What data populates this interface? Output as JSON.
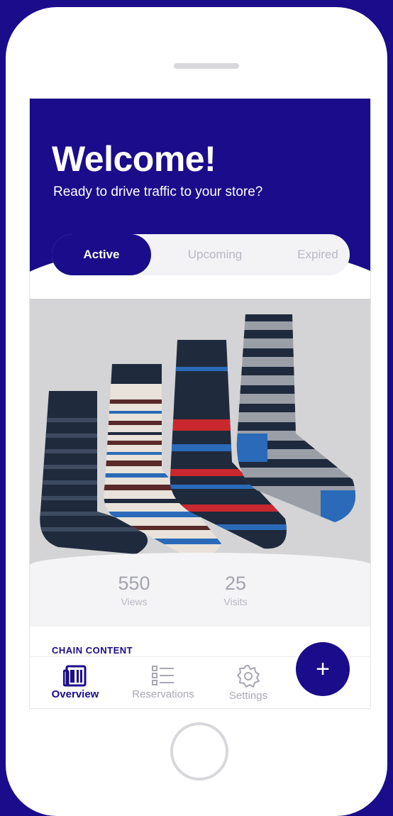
{
  "header": {
    "title": "Welcome!",
    "subtitle": "Ready to drive traffic to your store?"
  },
  "tabs": [
    {
      "label": "Active",
      "selected": true
    },
    {
      "label": "Upcoming",
      "selected": false
    },
    {
      "label": "Expired",
      "selected": false
    }
  ],
  "product": {
    "image_icon": "striped-socks-photo",
    "background_color": "#d4d4d6"
  },
  "stats": [
    {
      "value": "550",
      "label": "Views"
    },
    {
      "value": "25",
      "label": "Visits"
    }
  ],
  "section": {
    "label": "CHAIN CONTENT"
  },
  "fab": {
    "label": "+",
    "icon": "plus-icon"
  },
  "bottom_nav": [
    {
      "label": "Overview",
      "icon": "newspaper-icon",
      "active": true
    },
    {
      "label": "Reservations",
      "icon": "list-icon",
      "active": false
    },
    {
      "label": "Settings",
      "icon": "gear-icon",
      "active": false
    }
  ],
  "colors": {
    "brand": "#1a0c8a",
    "muted_text": "#b8b8c4",
    "surface": "#f4f4f6"
  }
}
